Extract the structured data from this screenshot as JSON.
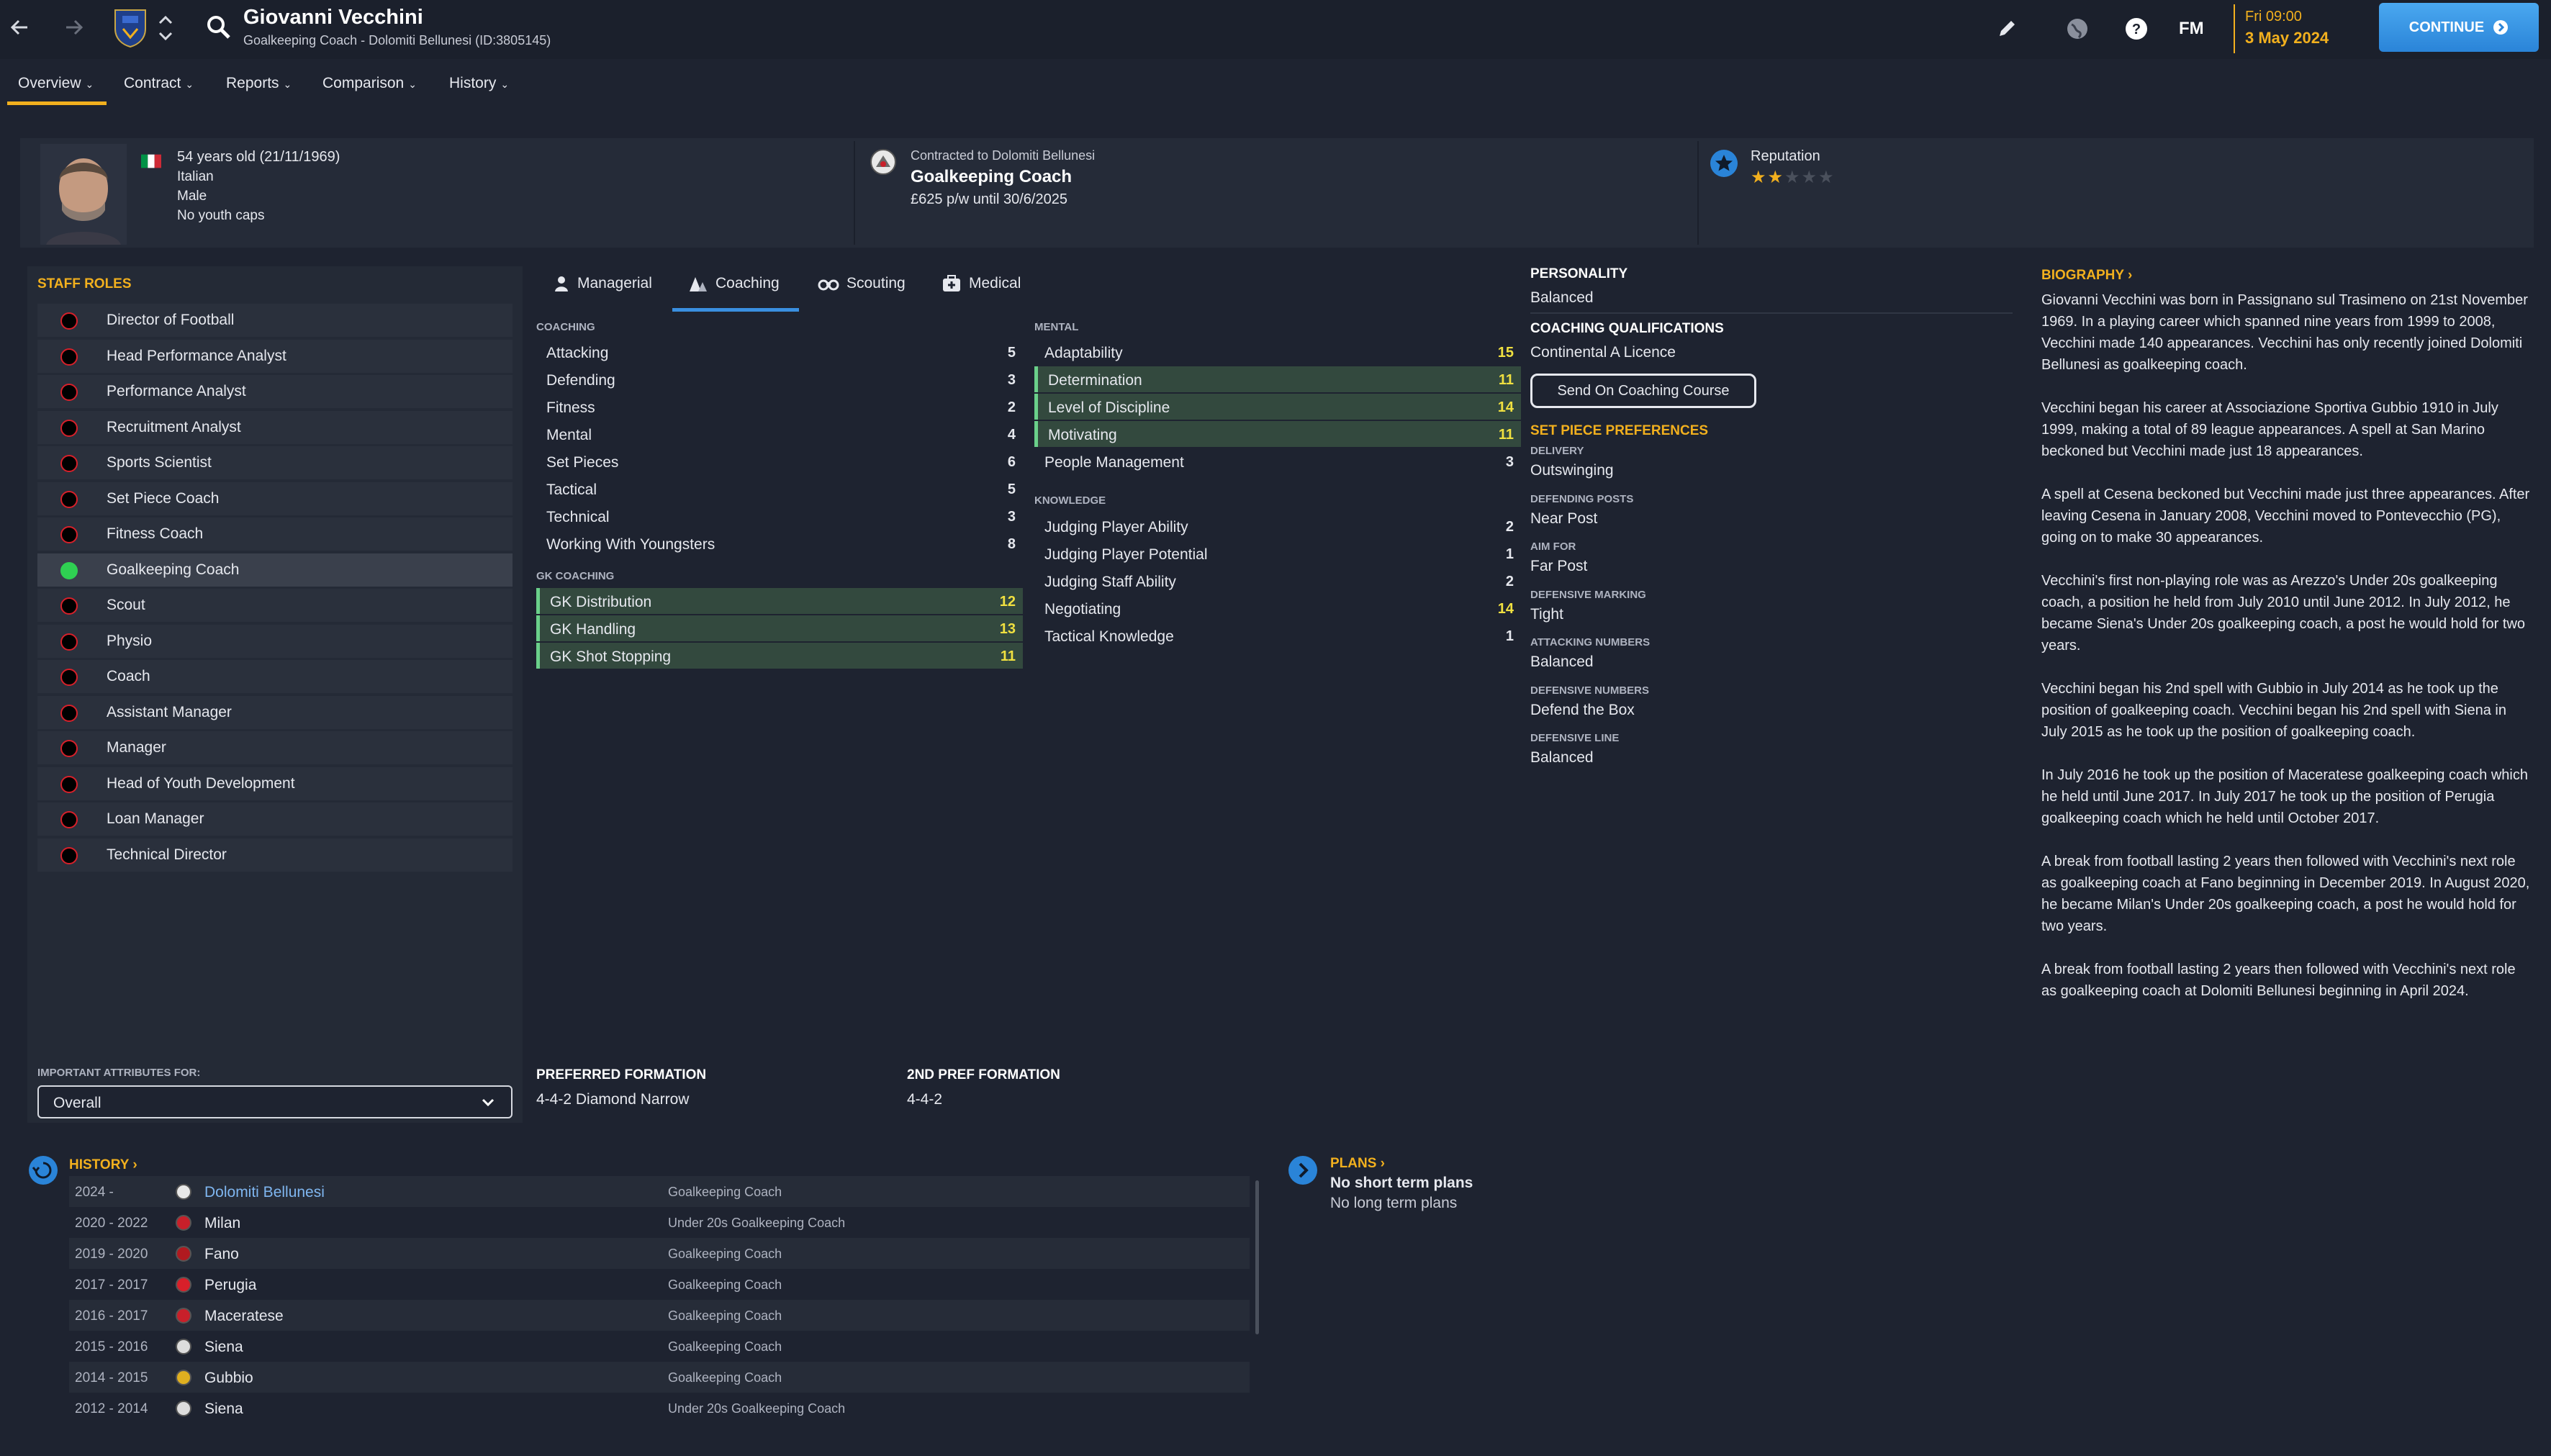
{
  "topbar": {
    "name": "Giovanni Vecchini",
    "subtitle": "Goalkeeping Coach - Dolomiti Bellunesi (ID:3805145)",
    "fm_label": "FM",
    "time": "Fri 09:00",
    "date": "3 May 2024",
    "continue_label": "CONTINUE"
  },
  "menu": {
    "items": [
      "Overview",
      "Contract",
      "Reports",
      "Comparison",
      "History"
    ]
  },
  "header": {
    "age": "54 years old (21/11/1969)",
    "nationality": "Italian",
    "gender": "Male",
    "caps": "No youth caps",
    "contract_label": "Contracted to Dolomiti Bellunesi",
    "job": "Goalkeeping Coach",
    "wage": "£625 p/w until 30/6/2025",
    "reputation_label": "Reputation",
    "reputation_stars": 2,
    "reputation_max": 5
  },
  "staff_roles": {
    "title": "STAFF ROLES",
    "items": [
      "Director of Football",
      "Head Performance Analyst",
      "Performance Analyst",
      "Recruitment Analyst",
      "Sports Scientist",
      "Set Piece Coach",
      "Fitness Coach",
      "Goalkeeping Coach",
      "Scout",
      "Physio",
      "Coach",
      "Assistant Manager",
      "Manager",
      "Head of Youth Development",
      "Loan Manager",
      "Technical Director"
    ],
    "selected_index": 7,
    "important_label": "IMPORTANT ATTRIBUTES FOR:",
    "important_value": "Overall"
  },
  "attr_tabs": [
    "Managerial",
    "Coaching",
    "Scouting",
    "Medical"
  ],
  "coaching": {
    "label": "COACHING",
    "items": [
      {
        "name": "Attacking",
        "value": "5"
      },
      {
        "name": "Defending",
        "value": "3"
      },
      {
        "name": "Fitness",
        "value": "2"
      },
      {
        "name": "Mental",
        "value": "4"
      },
      {
        "name": "Set Pieces",
        "value": "6"
      },
      {
        "name": "Tactical",
        "value": "5"
      },
      {
        "name": "Technical",
        "value": "3"
      },
      {
        "name": "Working With Youngsters",
        "value": "8"
      }
    ]
  },
  "gk_coaching": {
    "label": "GK COACHING",
    "items": [
      {
        "name": "GK Distribution",
        "value": "12"
      },
      {
        "name": "GK Handling",
        "value": "13"
      },
      {
        "name": "GK Shot Stopping",
        "value": "11"
      }
    ]
  },
  "mental": {
    "label": "MENTAL",
    "items": [
      {
        "name": "Adaptability",
        "value": "15"
      },
      {
        "name": "Determination",
        "value": "11"
      },
      {
        "name": "Level of Discipline",
        "value": "14"
      },
      {
        "name": "Motivating",
        "value": "11"
      },
      {
        "name": "People Management",
        "value": "3"
      }
    ]
  },
  "knowledge": {
    "label": "KNOWLEDGE",
    "items": [
      {
        "name": "Judging Player Ability",
        "value": "2"
      },
      {
        "name": "Judging Player Potential",
        "value": "1"
      },
      {
        "name": "Judging Staff Ability",
        "value": "2"
      },
      {
        "name": "Negotiating",
        "value": "14"
      },
      {
        "name": "Tactical Knowledge",
        "value": "1"
      }
    ]
  },
  "formation": {
    "pref_label": "PREFERRED FORMATION",
    "pref_value": "4-4-2 Diamond Narrow",
    "second_label": "2ND PREF FORMATION",
    "second_value": "4-4-2"
  },
  "personality": {
    "label": "PERSONALITY",
    "value": "Balanced",
    "qual_label": "COACHING QUALIFICATIONS",
    "qual_value": "Continental A Licence",
    "course_button": "Send On Coaching Course"
  },
  "set_piece": {
    "title": "SET PIECE PREFERENCES",
    "items": [
      {
        "label": "DELIVERY",
        "value": "Outswinging"
      },
      {
        "label": "DEFENDING POSTS",
        "value": "Near Post"
      },
      {
        "label": "AIM FOR",
        "value": "Far Post"
      },
      {
        "label": "DEFENSIVE MARKING",
        "value": "Tight"
      },
      {
        "label": "ATTACKING NUMBERS",
        "value": "Balanced"
      },
      {
        "label": "DEFENSIVE NUMBERS",
        "value": "Defend the Box"
      },
      {
        "label": "DEFENSIVE LINE",
        "value": "Balanced"
      }
    ]
  },
  "biography": {
    "title": "BIOGRAPHY",
    "paragraphs": [
      "Giovanni Vecchini was born in Passignano sul Trasimeno on 21st November 1969. In a playing career which spanned nine years from 1999 to 2008, Vecchini made 140 appearances. Vecchini has only recently joined Dolomiti Bellunesi as goalkeeping coach.",
      "Vecchini began his career at Associazione Sportiva Gubbio 1910 in July 1999, making a total of 89 league appearances. A spell at San Marino beckoned but Vecchini made just 18 appearances.",
      "A spell at Cesena beckoned but Vecchini made just three appearances. After leaving Cesena in January 2008, Vecchini moved to Pontevecchio (PG), going on to make 30 appearances.",
      "Vecchini's first non-playing role was as Arezzo's Under 20s goalkeeping coach, a position he held from July 2010 until June 2012. In July 2012, he became Siena's Under 20s goalkeeping coach, a post he would hold for two years.",
      "Vecchini began his 2nd spell with Gubbio in July 2014 as he took up the position of goalkeeping coach. Vecchini began his 2nd spell with Siena in July 2015 as he took up the position of goalkeeping coach.",
      "In July 2016 he took up the position of Maceratese goalkeeping coach which he held until June 2017. In July 2017 he took up the position of Perugia goalkeeping coach which he held until October 2017.",
      "A break from football lasting 2 years then followed with Vecchini's next role as goalkeeping coach at Fano beginning in December 2019. In August 2020, he became Milan's Under 20s goalkeeping coach, a post he would hold for two years.",
      "A break from football lasting 2 years then followed with Vecchini's next role as goalkeeping coach at Dolomiti Bellunesi beginning in April 2024."
    ]
  },
  "history": {
    "title": "HISTORY",
    "rows": [
      {
        "years": "2024 -",
        "club": "Dolomiti Bellunesi",
        "role": "Goalkeeping Coach",
        "color": "#e8e8e8"
      },
      {
        "years": "2020 - 2022",
        "club": "Milan",
        "role": "Under 20s Goalkeeping Coach",
        "color": "#c8202a"
      },
      {
        "years": "2019 - 2020",
        "club": "Fano",
        "role": "Goalkeeping Coach",
        "color": "#b01a20"
      },
      {
        "years": "2017 - 2017",
        "club": "Perugia",
        "role": "Goalkeeping Coach",
        "color": "#d8202a"
      },
      {
        "years": "2016 - 2017",
        "club": "Maceratese",
        "role": "Goalkeeping Coach",
        "color": "#c8202a"
      },
      {
        "years": "2015 - 2016",
        "club": "Siena",
        "role": "Goalkeeping Coach",
        "color": "#dddddd"
      },
      {
        "years": "2014 - 2015",
        "club": "Gubbio",
        "role": "Goalkeeping Coach",
        "color": "#e0b020"
      },
      {
        "years": "2012 - 2014",
        "club": "Siena",
        "role": "Under 20s Goalkeeping Coach",
        "color": "#dddddd"
      }
    ]
  },
  "plans": {
    "title": "PLANS",
    "short": "No short term plans",
    "long": "No long term plans"
  },
  "colors": {
    "accent": "#f2b01e",
    "highlight_row": "#33493e",
    "highlight_value": "#f0e040",
    "continue": "#2a84d8"
  }
}
